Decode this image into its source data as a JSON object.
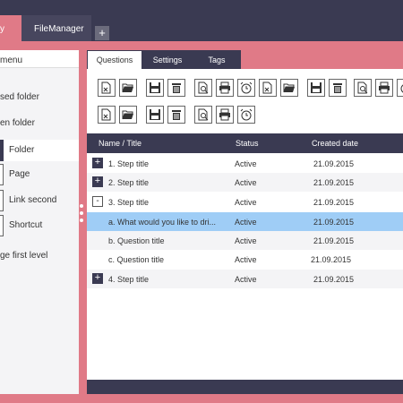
{
  "window": {
    "tabs": [
      {
        "label": "y",
        "active": true
      },
      {
        "label": "FileManager",
        "active": false
      }
    ],
    "add_tab": "+"
  },
  "left": {
    "header": "menu",
    "items": [
      "sed folder",
      "en folder"
    ],
    "types": [
      {
        "label": "Folder",
        "selected": true
      },
      {
        "label": "Page",
        "selected": false
      },
      {
        "label": "Link second",
        "selected": false
      },
      {
        "label": "Shortcut",
        "selected": false
      }
    ],
    "footer": "ge first level"
  },
  "main": {
    "subtabs": [
      "Questions",
      "Settings",
      "Tags"
    ],
    "toolbar_icons_row1": [
      "file-delete-icon",
      "folder-open-icon",
      "save-icon",
      "trash-icon",
      "file-search-icon",
      "print-icon",
      "alarm-clock-icon",
      "file-delete-icon",
      "folder-open-icon",
      "save-icon",
      "trash-icon",
      "file-search-icon",
      "print-icon",
      "alarm-clock-icon"
    ],
    "toolbar_icons_row2": [
      "file-delete-icon",
      "folder-open-icon",
      "save-icon",
      "trash-icon",
      "file-search-icon",
      "print-icon",
      "alarm-clock-icon"
    ],
    "table": {
      "columns": [
        "Name / Title",
        "Status",
        "Created date"
      ],
      "rows": [
        {
          "expander": "+",
          "title": "1. Step title",
          "status": "Active",
          "date": "21.09.2015"
        },
        {
          "expander": "+",
          "title": "2. Step title",
          "status": "Active",
          "date": "21.09.2015"
        },
        {
          "expander": "-",
          "title": "3. Step title",
          "status": "Active",
          "date": "21.09.2015"
        },
        {
          "expander": "",
          "title": "a. What would you like to dri...",
          "status": "Active",
          "date": "21.09.2015"
        },
        {
          "expander": "",
          "title": "b. Question title",
          "status": "Active",
          "date": "21.09.2015"
        },
        {
          "expander": "",
          "title": "c. Question title",
          "status": "Active",
          "date": "21.09.2015"
        },
        {
          "expander": "+",
          "title": "4. Step title",
          "status": "Active",
          "date": "21.09.2015"
        }
      ]
    }
  },
  "colors": {
    "accent_pink": "#e07a87",
    "dark_navy": "#3a3a52",
    "selected_row": "#9fcdf6"
  }
}
